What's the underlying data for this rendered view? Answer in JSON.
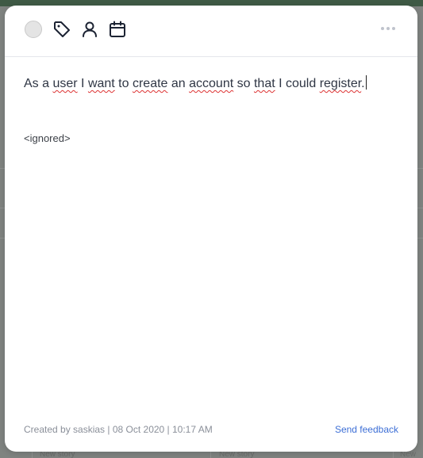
{
  "story": {
    "words": [
      "As a ",
      "user",
      " I ",
      "want",
      " to ",
      "create",
      " an ",
      "account",
      " so ",
      "that",
      " I could ",
      "register",
      "."
    ],
    "ignored_tag": "<ignored>"
  },
  "header": {
    "icons": [
      "status-circle",
      "tag-icon",
      "user-icon",
      "calendar-icon",
      "more-icon"
    ]
  },
  "footer": {
    "created_by": "Created by saskias | 08 Oct 2020 | 10:17 AM",
    "feedback_link": "Send feedback"
  },
  "background": {
    "new_story_label": "New story"
  },
  "colors": {
    "card_bg": "#ffffff",
    "link": "#3d6fd6",
    "text": "#2f3644",
    "meta": "#8a8f99",
    "spellcheck": "#dd3333"
  }
}
